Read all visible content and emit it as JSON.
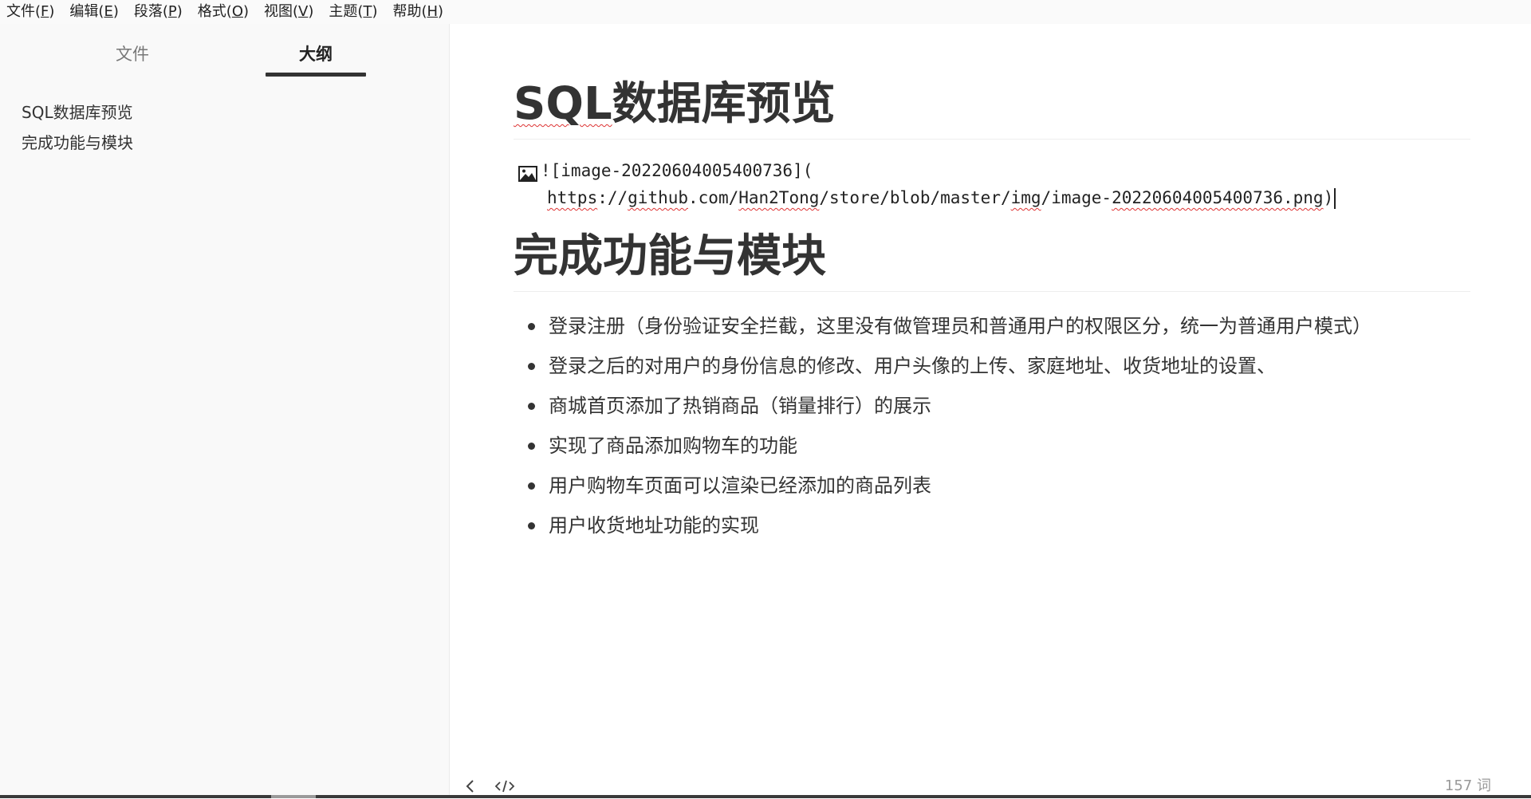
{
  "menubar": {
    "items": [
      {
        "label": "文件",
        "mnemonic": "F"
      },
      {
        "label": "编辑",
        "mnemonic": "E"
      },
      {
        "label": "段落",
        "mnemonic": "P"
      },
      {
        "label": "格式",
        "mnemonic": "O"
      },
      {
        "label": "视图",
        "mnemonic": "V"
      },
      {
        "label": "主题",
        "mnemonic": "T"
      },
      {
        "label": "帮助",
        "mnemonic": "H"
      }
    ]
  },
  "sidebar": {
    "tabs": {
      "files": "文件",
      "outline": "大纲"
    },
    "active_tab": "outline",
    "outline_items": [
      "SQL数据库预览",
      "完成功能与模块"
    ]
  },
  "document": {
    "heading1": {
      "spell_part": "SQL",
      "rest": "数据库预览"
    },
    "image_markdown": {
      "prefix": "![image-20220604005400736](",
      "url_parts": [
        {
          "text": "https",
          "wavy": true
        },
        {
          "text": "://",
          "wavy": false
        },
        {
          "text": "github",
          "wavy": true
        },
        {
          "text": ".com/",
          "wavy": false
        },
        {
          "text": "Han2Tong",
          "wavy": true
        },
        {
          "text": "/store/blob/master/",
          "wavy": false
        },
        {
          "text": "img",
          "wavy": true
        },
        {
          "text": "/image-",
          "wavy": false
        },
        {
          "text": "20220604005400736.png",
          "wavy": true
        },
        {
          "text": ")",
          "wavy": false
        }
      ]
    },
    "heading2": "完成功能与模块",
    "bullets": [
      "登录注册（身份验证安全拦截，这里没有做管理员和普通用户的权限区分，统一为普通用户模式）",
      "登录之后的对用户的身份信息的修改、用户头像的上传、家庭地址、收货地址的设置、",
      "商城首页添加了热销商品（销量排行）的展示",
      "实现了商品添加购物车的功能",
      "用户购物车页面可以渲染已经添加的商品列表",
      "用户收货地址功能的实现"
    ]
  },
  "statusbar": {
    "word_count": "157 词",
    "icons": [
      "chevron-left-icon",
      "source-code-icon"
    ]
  }
}
